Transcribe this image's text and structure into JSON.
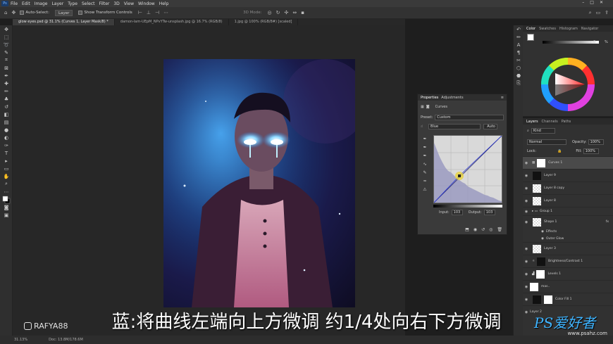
{
  "menu": {
    "app_badge": "Ps",
    "items": [
      "File",
      "Edit",
      "Image",
      "Layer",
      "Type",
      "Select",
      "Filter",
      "3D",
      "View",
      "Window",
      "Help"
    ]
  },
  "options": {
    "auto_select_label": "Auto-Select:",
    "auto_select_target": "Layer",
    "transform_label": "Show Transform Controls",
    "mode3d_label": "3D Mode:"
  },
  "tabs": [
    {
      "label": "glow eyes.psd @ 31.1% (Curves 1, Layer Mask/8) *",
      "active": true
    },
    {
      "label": "damon-lam-UEpM_NPvYTw-unsplash.jpg @ 16.7% (RGB/8)",
      "active": false
    },
    {
      "label": "1.jpg @ 100% (RGB/8#) [scaled]",
      "active": false
    }
  ],
  "status": {
    "zoom": "31.13%",
    "doc": "Doc: 13.8M/178.6M"
  },
  "color_panel": {
    "tabs": [
      "Color",
      "Swatches",
      "Histogram",
      "Navigator"
    ],
    "slider_value": "0",
    "percent": "%"
  },
  "properties": {
    "tabs": [
      "Properties",
      "Adjustments"
    ],
    "title": "Curves",
    "preset_label": "Preset:",
    "preset_value": "Custom",
    "channel": "Blue",
    "auto_label": "Auto",
    "input_label": "Input:",
    "input_value": "103",
    "output_label": "Output:",
    "output_value": "103"
  },
  "layers_panel": {
    "tabs": [
      "Layers",
      "Channels",
      "Paths"
    ],
    "kind_label": "Kind",
    "blend_mode": "Normal",
    "opacity_label": "Opacity:",
    "opacity_value": "100%",
    "lock_label": "Lock:",
    "fill_label": "Fill:",
    "fill_value": "100%",
    "layers": [
      {
        "name": "Curves 1",
        "type": "adjustment",
        "selected": true
      },
      {
        "name": "Layer 9",
        "type": "dark"
      },
      {
        "name": "Layer 8 copy",
        "type": "transparent"
      },
      {
        "name": "Layer 8",
        "type": "transparent"
      },
      {
        "name": "Group 1",
        "type": "group"
      },
      {
        "name": "Shape 1",
        "type": "transparent",
        "fx": "fx"
      },
      {
        "name": "Effects",
        "type": "effects"
      },
      {
        "name": "Outer Glow",
        "type": "effect"
      },
      {
        "name": "Layer 3",
        "type": "transparent"
      },
      {
        "name": "Brightness/Contrast 1",
        "type": "adjustment"
      },
      {
        "name": "Levels 1",
        "type": "adjustment"
      },
      {
        "name": "mas..",
        "type": "photo"
      },
      {
        "name": "Color Fill 1",
        "type": "fill"
      },
      {
        "name": "Layer 2",
        "type": "photo"
      }
    ]
  },
  "overlay": {
    "subtitle": "蓝:将曲线左端向上方微调 约1/4处向右下方微调",
    "watermark": "RAFYA88",
    "logo_text": "PS爱好者",
    "logo_url": "www.psahz.com"
  },
  "colors": {
    "accent": "#2d7cd6",
    "curve_point": "#e8d23a"
  }
}
